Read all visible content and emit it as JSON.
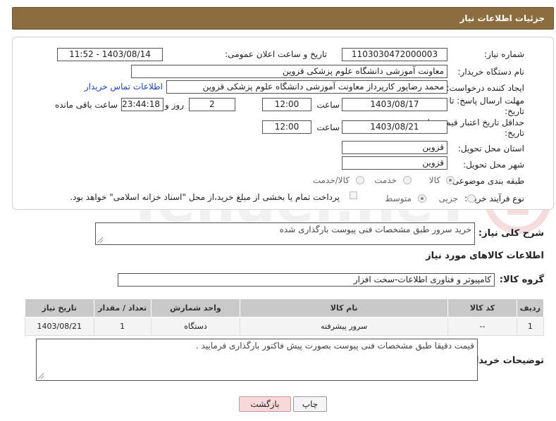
{
  "header": {
    "title": "جزئیات اطلاعات نیاز"
  },
  "form": {
    "need_number_label": "شماره نیاز:",
    "need_number": "1103030472000003",
    "announce_label": "تاریخ و ساعت اعلان عمومی:",
    "announce_value": "1403/08/14 - 11:52",
    "buyer_org_label": "نام دستگاه خریدار:",
    "buyer_org": "معاونت آموزشی دانشگاه علوم پزشکی قزوین",
    "requester_label": "ایجاد کننده درخواست:",
    "requester": "محمد رضاپور کارپرداز معاونت آموزشی دانشگاه علوم پزشکی قزوین",
    "contact_link": "اطلاعات تماس خریدار",
    "deadline_label_1": "مهلت ارسال پاسخ: تا",
    "deadline_label_2": "تاریخ:",
    "deadline_date": "1403/08/17",
    "time_label": "ساعت",
    "deadline_time": "12:00",
    "days_value": "2",
    "days_label": "روز و",
    "remaining_time": "23:44:18",
    "remaining_label": "ساعت باقی مانده",
    "validity_label_1": "حداقل تاریخ اعتبار قیمت: تا",
    "validity_label_2": "تاریخ:",
    "validity_date": "1403/08/21",
    "validity_time": "12:00",
    "province_label": "استان محل تحویل:",
    "province": "قزوین",
    "city_label": "شهر محل تحویل:",
    "city": "قزوین",
    "category_label": "طبقه بندی موضوعی:",
    "category_options": [
      "کالا",
      "خدمت",
      "کالا/خدمت"
    ],
    "process_label": "نوع فرآیند خرید :",
    "process_options": [
      "جزیی",
      "متوسط"
    ],
    "payment_note": "پرداخت تمام یا بخشی از مبلغ خرید،از محل \"اسناد خزانه اسلامی\" خواهد بود."
  },
  "summary": {
    "label": "شرح کلی نیاز:",
    "text": "خرید سرور طبق مشخصات فنی پیوست بارگذاری شده"
  },
  "goods": {
    "section_title": "اطلاعات کالاهای مورد نیاز",
    "group_label": "گروه کالا:",
    "group_value": "کامپیوتر و فناوری اطلاعات-سخت افزار",
    "columns": [
      "ردیف",
      "کد کالا",
      "نام کالا",
      "واحد شمارش",
      "تعداد / مقدار",
      "تاریخ نیاز"
    ],
    "rows": [
      [
        "1",
        "--",
        "سرور پیشرفته",
        "دستگاه",
        "1",
        "1403/08/21"
      ]
    ]
  },
  "buyer_notes": {
    "label": "توضیحات خریدار:",
    "text": "قیمت دقیقا طبق مشخصات فنی پیوست بصورت پیش  فاکتور بارگذاری فرمایید ."
  },
  "buttons": {
    "print": "چاپ",
    "back": "بازگشت"
  },
  "colors": {
    "header": "#8b6d3f",
    "back_button": "#f8d8d8",
    "link": "#1a44b8"
  }
}
